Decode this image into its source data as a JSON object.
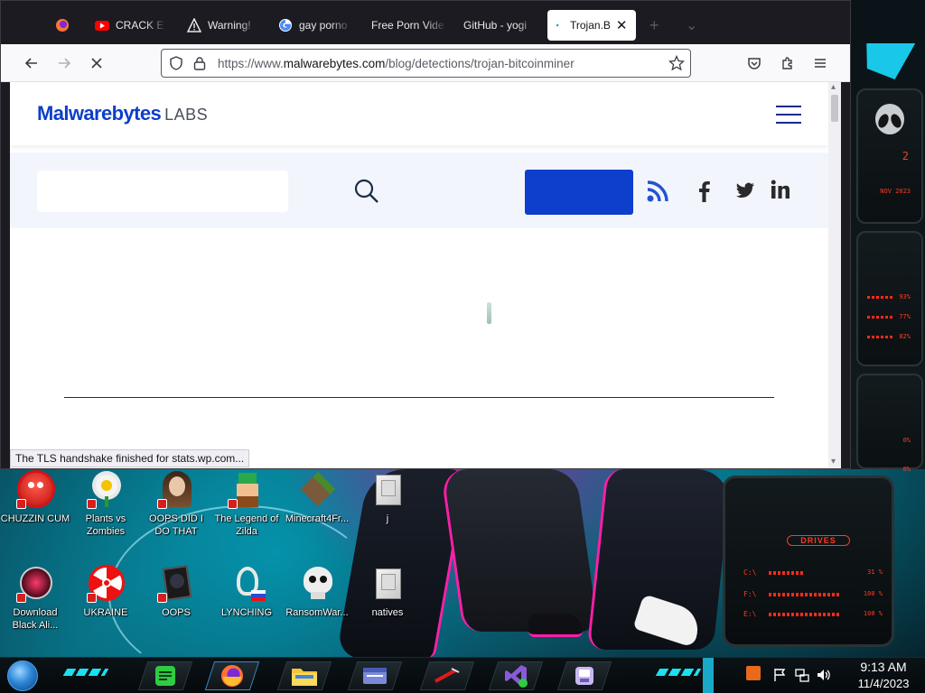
{
  "browser": {
    "tabs": [
      {
        "label": "",
        "icon": "firefox-icon",
        "active": false
      },
      {
        "label": "CRACK E",
        "icon": "youtube-icon",
        "active": false
      },
      {
        "label": "Warning!",
        "icon": "warning-icon",
        "active": false
      },
      {
        "label": "gay porno",
        "icon": "google-icon",
        "active": false
      },
      {
        "label": "Free Porn Vide",
        "icon": "",
        "active": false
      },
      {
        "label": "GitHub - yogi",
        "icon": "",
        "active": false
      },
      {
        "label": "Trojan.B",
        "icon": "loading-dot-icon",
        "active": true
      }
    ],
    "new_tab_label": "+",
    "tab_list_label": "⌄",
    "url_prefix": "https://www.",
    "url_domain": "malwarebytes.com",
    "url_path": "/blog/detections/trojan-bitcoinminer",
    "status_text": "The TLS handshake finished for stats.wp.com..."
  },
  "site": {
    "logo_text": "Malwarebytes",
    "logo_suffix": "LABS",
    "search_placeholder": "",
    "cta_label": "",
    "brand_color": "#0d3ecc"
  },
  "desktop": {
    "icons": [
      {
        "label": "CHUZZIN CUM",
        "icon": "red-fuzzball-icon"
      },
      {
        "label": "Plants vs Zombies",
        "icon": "flower-icon"
      },
      {
        "label": "OOPS DID I DO THAT",
        "icon": "portrait-icon"
      },
      {
        "label": "The Legend of Zilda",
        "icon": "pixel-hero-icon"
      },
      {
        "label": "Minecraft4Fr...",
        "icon": "minecraft-block-icon"
      },
      {
        "label": "j",
        "icon": "folder-icon"
      },
      {
        "label": "Download Black Ali...",
        "icon": "alien-orb-icon"
      },
      {
        "label": "UKRAINE",
        "icon": "radiation-icon"
      },
      {
        "label": "OOPS",
        "icon": "reader-icon"
      },
      {
        "label": "LYNCHING",
        "icon": "noose-icon"
      },
      {
        "label": "RansomWar...",
        "icon": "skull-icon"
      },
      {
        "label": "natives",
        "icon": "folder-icon"
      }
    ]
  },
  "widget": {
    "top_value": "2",
    "date_text": "NOV 2023",
    "readouts": [
      "93%",
      "77%",
      "82%",
      "0%",
      "0%"
    ],
    "drives_title": "DRIVES",
    "drives": [
      {
        "letter": "C:\\",
        "value": "31 %"
      },
      {
        "letter": "F:\\",
        "value": "100 %"
      },
      {
        "letter": "E:\\",
        "value": "100 %"
      }
    ]
  },
  "taskbar": {
    "time": "9:13 AM",
    "date": "11/4/2023"
  }
}
